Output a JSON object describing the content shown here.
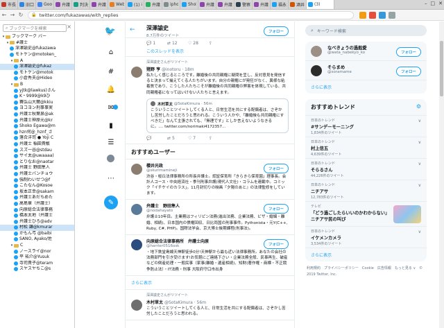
{
  "browser": {
    "tabs": [
      {
        "label": "市長の",
        "color": "#c0392b"
      },
      {
        "label": "旧口",
        "color": "#2e86de"
      },
      {
        "label": "Googl",
        "color": "#4285f4"
      },
      {
        "label": "弁護",
        "color": "#8e44ad"
      },
      {
        "label": "判決",
        "color": "#16a085"
      },
      {
        "label": "弁護",
        "color": "#8e44ad"
      },
      {
        "label": "WebL",
        "color": "#e67e22"
      },
      {
        "label": "(1) 非",
        "color": "#1da1f2"
      },
      {
        "label": "弁護士",
        "color": "#27ae60"
      },
      {
        "label": "iphon",
        "color": "#7f8c8d"
      },
      {
        "label": "Shok",
        "color": "#1da1f2"
      },
      {
        "label": "弁護",
        "color": "#8e44ad"
      },
      {
        "label": "弁護",
        "color": "#8e44ad"
      },
      {
        "label": "警察",
        "color": "#2c3e50"
      },
      {
        "label": "弁護",
        "color": "#8e44ad"
      },
      {
        "label": "福永",
        "color": "#1da1f2"
      },
      {
        "label": "酒井",
        "color": "#d35400"
      },
      {
        "label": "(3)",
        "color": "#1da1f2",
        "active": true
      }
    ],
    "url": "twitter.com/fukazawas/with_replies"
  },
  "bookmarks": {
    "search_placeholder": "ブックマークを検索",
    "close": "×",
    "items": [
      {
        "text": "ブックマーク バー",
        "type": "folder",
        "indent": 0,
        "tw": "▾"
      },
      {
        "text": "#護士",
        "type": "folder",
        "indent": 1,
        "tw": "▾"
      },
      {
        "text": "深澤諭史@fukazawa",
        "type": "item",
        "indent": 2
      },
      {
        "text": "モトケン@motoken_",
        "type": "item",
        "indent": 2
      },
      {
        "text": "A",
        "type": "folder",
        "indent": 2,
        "tw": "▾"
      },
      {
        "text": "深澤諭史@fukaz",
        "type": "item",
        "indent": 3,
        "selected": true
      },
      {
        "text": "モトケン@motok",
        "type": "item",
        "indent": 3
      },
      {
        "text": "小倉秀夫@Hideo",
        "type": "item",
        "indent": 3
      },
      {
        "text": "B",
        "type": "folder",
        "indent": 2,
        "tw": "▾"
      },
      {
        "text": "yjtk@lawkus)さん",
        "type": "item",
        "indent": 3
      },
      {
        "text": "K・9999@k9ひ",
        "type": "item",
        "indent": 3
      },
      {
        "text": "賽弘山大爾@kkiu",
        "type": "item",
        "indent": 3
      },
      {
        "text": "ヨコヨン刑事事実",
        "type": "item",
        "indent": 3
      },
      {
        "text": "弁護士秋葉泉@ak",
        "type": "item",
        "indent": 3
      },
      {
        "text": "弁護士神原元@kr",
        "type": "item",
        "indent": 3
      },
      {
        "text": "Shoko Egawa@m",
        "type": "item",
        "indent": 3
      },
      {
        "text": "hzn何@_hznf_さ",
        "type": "item",
        "indent": 3
      },
      {
        "text": "落合洋司 ● Yoji C",
        "type": "item",
        "indent": 3
      },
      {
        "text": "弁護士 稲田貴敏",
        "type": "item",
        "indent": 3
      },
      {
        "text": "スズ一谷@stdau",
        "type": "item",
        "indent": 3
      },
      {
        "text": "サイ太@uwaaaa)",
        "type": "item",
        "indent": 3
      },
      {
        "text": "とりなお@naotar",
        "type": "item",
        "indent": 3
      },
      {
        "text": "弁護士 野田隼人",
        "type": "item",
        "indent": 3
      },
      {
        "text": "弁護士バンチョウ",
        "type": "item",
        "indent": 3
      },
      {
        "text": "強制わいせつ@f",
        "type": "item",
        "indent": 3
      },
      {
        "text": "こたなん@Kosoe",
        "type": "item",
        "indent": 3
      },
      {
        "text": "坂本正幸@sakam",
        "type": "item",
        "indent": 3
      },
      {
        "text": "弁護士あだちめた",
        "type": "item",
        "indent": 3
      },
      {
        "text": "高島章（弁護士）",
        "type": "item",
        "indent": 3
      },
      {
        "text": "向原総合法律事務",
        "type": "item",
        "indent": 3
      },
      {
        "text": "橋本太地（弁護士",
        "type": "item",
        "indent": 3
      },
      {
        "text": "弁護士ひろ@adv",
        "type": "item",
        "indent": 3
      },
      {
        "text": "村松 謙@kmurar",
        "type": "item",
        "indent": 3,
        "selected": true
      },
      {
        "text": "かもん弓 @baibi",
        "type": "item",
        "indent": 3
      },
      {
        "text": "SANO, Ayako/佐",
        "type": "item",
        "indent": 3
      },
      {
        "text": "C",
        "type": "folder",
        "indent": 2,
        "tw": "▾"
      },
      {
        "text": "ノースライ@nor",
        "type": "item",
        "indent": 3
      },
      {
        "text": "平 祐介@Yusuk",
        "type": "item",
        "indent": 3
      },
      {
        "text": "寺司貴子@teram",
        "type": "item",
        "indent": 3
      },
      {
        "text": "スヤスヤちこ@s",
        "type": "item",
        "indent": 3
      }
    ]
  },
  "timeline": {
    "header": {
      "back": "←",
      "name": "深澤諭史",
      "count": "8.7万件のツイート",
      "follow": "フォロー"
    },
    "top_actions": {
      "reply": "1",
      "retweet": "12",
      "like": "28"
    },
    "thread_link": "このスレッドを表示",
    "tweet1": {
      "retweet_note": "深澤諭史さんがリツイート",
      "name": "猪野 亨",
      "handle": "@inotoru · 18m",
      "body": "私たしく感じるところです。離婚後の共同親権に疑問を呈し、反対意見を発信すると決まって捕えてくる人たちがいます。自分の親権にが発狂がなく、異様な粘着質であり、こうした人たちこそが離婚後の共同親権の弊害を体現している、共同親権者になってはいけない人たちと言えます。",
      "quote": {
        "name": "木村草太",
        "handle": "@SotaKimura · 56m",
        "body": "こういうことツイートしてくる人と、日常生活を共にする配偶者は、さぞかし苦労したことだろうと思われる。こういう人かや、「離婚後も共同親権にすべきだ」なんて主張されても、「無理です」としか言えないようなきるに。.... twitter.com/norimaki4172357..."
      },
      "actions": {
        "reply": "",
        "retweet": "5",
        "like": "7"
      }
    },
    "recommend_title": "おすすめユーザー",
    "users": [
      {
        "name": "櫻井光政",
        "handle": "@skurimamineji",
        "follow": "フォロー",
        "bio": "渋谷・桜丘法律事務所の所長弁護士。認証保育所「きらきら保育園」理事長。会計人コース・中央経済社・季刊刑事弁護(現代人文社)・コラムを連載中。コミック「イチケイのカラス」。11月封切りの映画『夕陽のあと』の法律監修をしています。"
      },
      {
        "name": "弁護士　野田隼人",
        "handle": "@nodahayato",
        "follow": "フォロー",
        "bio": "弁護士10年目。主業務はフィリピン法務(進出法務、企業法務、ビザ・婚姻・離婚、相続)、日本国内の債権回収、日比両国の刑事事件。Pythonista・元Y(C++, Ruby, C#, PHP)。国際法学会、京大博士後期課程(刑事法)。"
      },
      {
        "name": "向原総合法律事務所　弁護士向原",
        "handle": "@harrier0516osk",
        "follow": "フォロー",
        "bio": "・地下鉄堂島線天神駅徒歩0分!天神駅から最も近い法律事務所。あなたの会社の法務部門を引き受けます!お気軽にご連絡下さい・企業法務全般、民事再生、破産などの倒産処理・一般民事（家事(離婚・遺産相続)、知財(著作権・商標・不正競争防止法）・IT法務・刑事 大阪府守口市出身"
      }
    ],
    "more_link": "さらに表示",
    "tweet2": {
      "retweet_note": "深澤諭史さんがリツイート",
      "name": "木村草太",
      "handle": "@SotaKimura · 56m",
      "body": "こういうことツイートしてくる人と、日常生活を共にする配偶者は、さぞかし苦労したことだろうと思われる。"
    }
  },
  "right": {
    "search_placeholder": "キーワード検索",
    "users": [
      {
        "name": "なべきょうの過般愛",
        "handle": "@wata_nabekyo_ko",
        "follow": "フォロー"
      },
      {
        "name": "そらまめ",
        "handle": "@soramame",
        "follow": "フォロー"
      }
    ],
    "more": "さらに表示",
    "trends_title": "おすすめトレンド",
    "trends": [
      {
        "cat": "日本のトレンド",
        "name": "#サンデーモーニング",
        "count": "1,834件のツイート"
      },
      {
        "cat": "日本のトレンド",
        "name": "村上信五",
        "count": "4,639件のツイート"
      },
      {
        "cat": "日本のトレンド",
        "name": "そらるさん",
        "count": "44,226件のツイート"
      },
      {
        "cat": "日本のトレンド",
        "name": "ニチアサ",
        "count": "12,783件のツイート"
      },
      {
        "cat": "テレビ",
        "name": "「どう過ごしたらいいのかわからない」ニチアサ民の叫び",
        "count": ""
      },
      {
        "cat": "日本のトレンド",
        "name": "イケメンカメラ",
        "count": "3,534件のツイート"
      }
    ],
    "trends_more": "さらに表示",
    "footer": "利用規約　プライバシーポリシー　Cookie　広告情報　もっと見る ∨　© 2019 Twitter, Inc."
  }
}
